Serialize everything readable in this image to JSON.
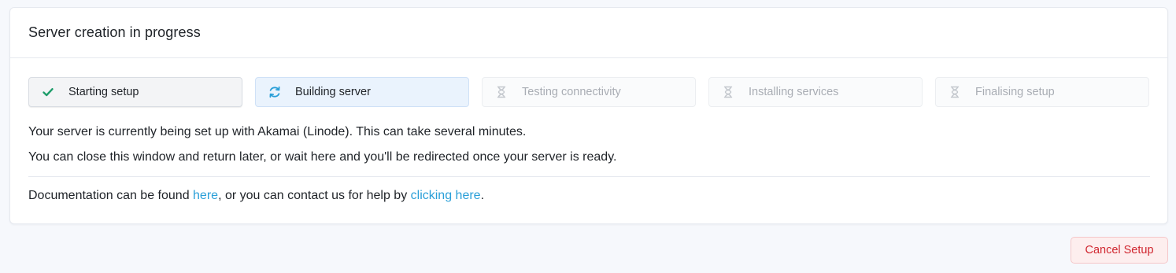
{
  "header": {
    "title": "Server creation in progress"
  },
  "steps": [
    {
      "label": "Starting setup",
      "status": "done",
      "icon": "check-icon"
    },
    {
      "label": "Building server",
      "status": "active",
      "icon": "refresh-icon"
    },
    {
      "label": "Testing connectivity",
      "status": "pending",
      "icon": "hourglass-icon"
    },
    {
      "label": "Installing services",
      "status": "pending",
      "icon": "hourglass-icon"
    },
    {
      "label": "Finalising setup",
      "status": "pending",
      "icon": "hourglass-icon"
    }
  ],
  "messages": {
    "line1": "Your server is currently being set up with Akamai (Linode). This can take several minutes.",
    "line2": "You can close this window and return later, or wait here and you'll be redirected once your server is ready."
  },
  "docs": {
    "prefix": "Documentation can be found ",
    "link1": "here",
    "middle": ", or you can contact us for help by ",
    "link2": "clicking here",
    "suffix": "."
  },
  "actions": {
    "cancel_label": "Cancel Setup"
  },
  "colors": {
    "done_check": "#1f9d6b",
    "active_icon": "#2a9fd8",
    "pending_icon": "#c3c7cd",
    "link": "#2a9fd8",
    "cancel_text": "#d0262f"
  }
}
